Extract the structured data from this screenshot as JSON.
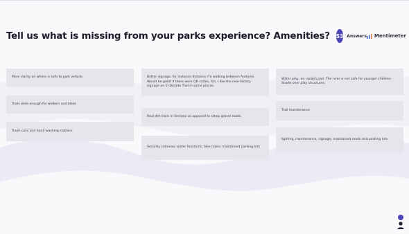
{
  "slide": {
    "question": "Tell us what is missing from your parks experience? Amenities?",
    "answers_count": "53",
    "answers_label": "Answers",
    "brand_name": "Mentimeter",
    "brand_icon": "bar-chart-icon",
    "accent_color": "#4b47b8"
  },
  "responses": [
    "More clarity on where is safe to park vehicle.",
    "Trails wide enough for walkers and bikes",
    "Trash cans and hand washing stations",
    "Better signage, for instance distance I'm walking between features. Would be great if there were QR codes, too. I like the new history signage on El Dorado Trail in some places.",
    "Real dirt trails in Serrano as opposed to steep gravel roads.",
    "Security cameras; water fountains; bike racks; maintained parking lots",
    "Water play, ex. splash pad. The river is not safe for younger children. Shade over play structures.",
    "Trail maintenance",
    "lighting, maintenance, signage, maintained roads and parking lots"
  ],
  "participants": {
    "icon": "user-icon"
  }
}
